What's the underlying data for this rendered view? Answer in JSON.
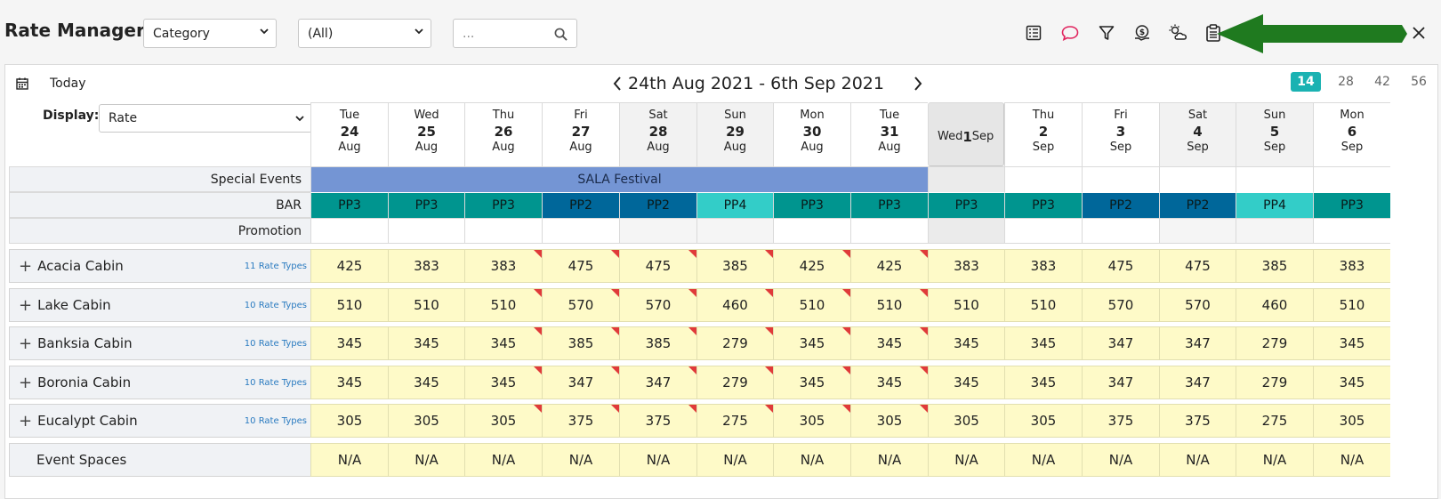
{
  "header": {
    "title": "Rate Manager",
    "category_select": "Category",
    "filter_select": "(All)",
    "search_placeholder": "..."
  },
  "toolbar_icons": [
    "list-icon",
    "comment-icon",
    "filter-icon",
    "money-icon",
    "weather-icon",
    "clipboard-icon",
    "close-icon"
  ],
  "nav": {
    "today_label": "Today",
    "date_range": "24th Aug 2021 - 6th Sep 2021",
    "day_options": [
      "14",
      "28",
      "42",
      "56"
    ],
    "active_day_option": "14"
  },
  "display": {
    "label": "Display:",
    "value": "Rate"
  },
  "dates": [
    {
      "dow": "Tue",
      "day": "24",
      "mon": "Aug",
      "weekend": false
    },
    {
      "dow": "Wed",
      "day": "25",
      "mon": "Aug",
      "weekend": false
    },
    {
      "dow": "Thu",
      "day": "26",
      "mon": "Aug",
      "weekend": false
    },
    {
      "dow": "Fri",
      "day": "27",
      "mon": "Aug",
      "weekend": false
    },
    {
      "dow": "Sat",
      "day": "28",
      "mon": "Aug",
      "weekend": true
    },
    {
      "dow": "Sun",
      "day": "29",
      "mon": "Aug",
      "weekend": true
    },
    {
      "dow": "Mon",
      "day": "30",
      "mon": "Aug",
      "weekend": false
    },
    {
      "dow": "Tue",
      "day": "31",
      "mon": "Aug",
      "weekend": false
    },
    {
      "dow": "Wed",
      "day": "1",
      "mon": "Sep",
      "weekend": false,
      "selected": true
    },
    {
      "dow": "Thu",
      "day": "2",
      "mon": "Sep",
      "weekend": false
    },
    {
      "dow": "Fri",
      "day": "3",
      "mon": "Sep",
      "weekend": false
    },
    {
      "dow": "Sat",
      "day": "4",
      "mon": "Sep",
      "weekend": true
    },
    {
      "dow": "Sun",
      "day": "5",
      "mon": "Sep",
      "weekend": true
    },
    {
      "dow": "Mon",
      "day": "6",
      "mon": "Sep",
      "weekend": false
    }
  ],
  "special_events": {
    "label": "Special Events",
    "event_name": "SALA Festival",
    "event_days": 8,
    "event_color": "#7495d4"
  },
  "bar": {
    "label": "BAR",
    "values": [
      "PP3",
      "PP3",
      "PP3",
      "PP2",
      "PP2",
      "PP4",
      "PP3",
      "PP3",
      "PP3",
      "PP3",
      "PP2",
      "PP2",
      "PP4",
      "PP3"
    ],
    "colors": {
      "PP2": "#00679a",
      "PP3": "#00958f",
      "PP4": "#33cdc8"
    }
  },
  "promotion": {
    "label": "Promotion"
  },
  "rooms": [
    {
      "name": "Acacia Cabin",
      "rate_types": "11 Rate Types",
      "rates": [
        "425",
        "383",
        "383",
        "475",
        "475",
        "385",
        "425",
        "425",
        "383",
        "383",
        "475",
        "475",
        "385",
        "383"
      ]
    },
    {
      "name": "Lake Cabin",
      "rate_types": "10 Rate Types",
      "rates": [
        "510",
        "510",
        "510",
        "570",
        "570",
        "460",
        "510",
        "510",
        "510",
        "510",
        "570",
        "570",
        "460",
        "510"
      ]
    },
    {
      "name": "Banksia Cabin",
      "rate_types": "10 Rate Types",
      "rates": [
        "345",
        "345",
        "345",
        "385",
        "385",
        "279",
        "345",
        "345",
        "345",
        "345",
        "347",
        "347",
        "279",
        "345"
      ]
    },
    {
      "name": "Boronia Cabin",
      "rate_types": "10 Rate Types",
      "rates": [
        "345",
        "345",
        "345",
        "347",
        "347",
        "279",
        "345",
        "345",
        "345",
        "345",
        "347",
        "347",
        "279",
        "345"
      ]
    },
    {
      "name": "Eucalypt Cabin",
      "rate_types": "10 Rate Types",
      "rates": [
        "305",
        "305",
        "305",
        "375",
        "375",
        "275",
        "305",
        "305",
        "305",
        "305",
        "375",
        "375",
        "275",
        "305"
      ]
    }
  ],
  "event_spaces": {
    "label": "Event Spaces",
    "value": "N/A"
  },
  "flagged_days": [
    2,
    3,
    4,
    5,
    6,
    7
  ],
  "accent_color": "#1ab2b2"
}
